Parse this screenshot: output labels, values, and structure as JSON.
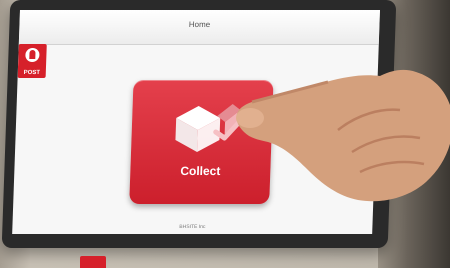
{
  "app": {
    "screen_title": "Home",
    "brand_text": "POST"
  },
  "tiles": [
    {
      "label": "Collect",
      "icon": "parcel-collect-icon"
    }
  ],
  "footer": {
    "text": "BHSITE Inc"
  },
  "colors": {
    "brand_red": "#d6202a",
    "screen_bg": "#f7f7f7"
  }
}
